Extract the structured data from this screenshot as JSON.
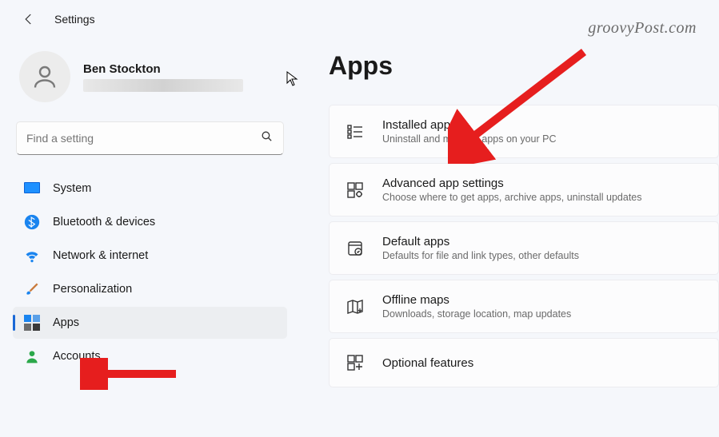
{
  "header": {
    "title": "Settings"
  },
  "watermark": "groovyPost.com",
  "user": {
    "name": "Ben Stockton"
  },
  "search": {
    "placeholder": "Find a setting"
  },
  "sidebar": {
    "items": [
      {
        "label": "System",
        "icon": "system"
      },
      {
        "label": "Bluetooth & devices",
        "icon": "bluetooth"
      },
      {
        "label": "Network & internet",
        "icon": "wifi"
      },
      {
        "label": "Personalization",
        "icon": "brush"
      },
      {
        "label": "Apps",
        "icon": "apps",
        "active": true
      },
      {
        "label": "Accounts",
        "icon": "account"
      }
    ]
  },
  "page": {
    "title": "Apps",
    "cards": [
      {
        "title": "Installed apps",
        "sub": "Uninstall and manage apps on your PC",
        "icon": "installed"
      },
      {
        "title": "Advanced app settings",
        "sub": "Choose where to get apps, archive apps, uninstall updates",
        "icon": "advanced"
      },
      {
        "title": "Default apps",
        "sub": "Defaults for file and link types, other defaults",
        "icon": "default"
      },
      {
        "title": "Offline maps",
        "sub": "Downloads, storage location, map updates",
        "icon": "maps"
      },
      {
        "title": "Optional features",
        "sub": "",
        "icon": "optional"
      }
    ]
  }
}
